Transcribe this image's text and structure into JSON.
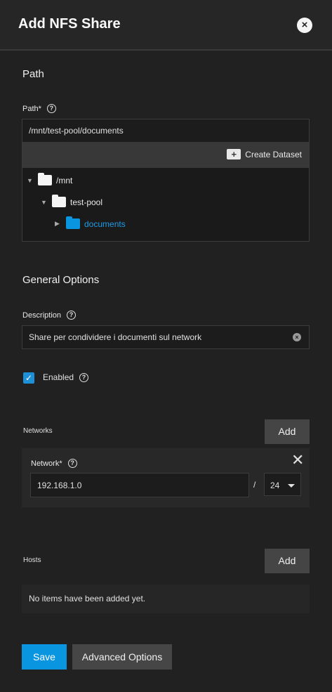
{
  "header": {
    "title": "Add NFS Share",
    "close_icon": "×"
  },
  "path_section": {
    "title": "Path",
    "label": "Path",
    "required_mark": "*",
    "value": "/mnt/test-pool/documents",
    "create_dataset_label": "Create Dataset",
    "tree": [
      {
        "arrow": "▼",
        "label": "/mnt"
      },
      {
        "arrow": "▼",
        "label": "test-pool"
      },
      {
        "arrow": "▶",
        "label": "documents"
      }
    ]
  },
  "general_section": {
    "title": "General Options",
    "description_label": "Description",
    "description_value": "Share per condividere i documenti sul network",
    "enabled_label": "Enabled",
    "enabled_checked": true
  },
  "networks": {
    "label": "Networks",
    "add_label": "Add",
    "network_label": "Network",
    "required_mark": "*",
    "network_value": "192.168.1.0",
    "slash": "/",
    "mask_value": "24"
  },
  "hosts": {
    "label": "Hosts",
    "add_label": "Add",
    "empty_text": "No items have been added yet."
  },
  "footer": {
    "save_label": "Save",
    "advanced_label": "Advanced Options"
  },
  "icons": {
    "help": "?",
    "check": "✓",
    "folder_plus": "+",
    "clear": "×",
    "close": "✕"
  },
  "colors": {
    "accent": "#0a95e0",
    "background": "#212121"
  }
}
